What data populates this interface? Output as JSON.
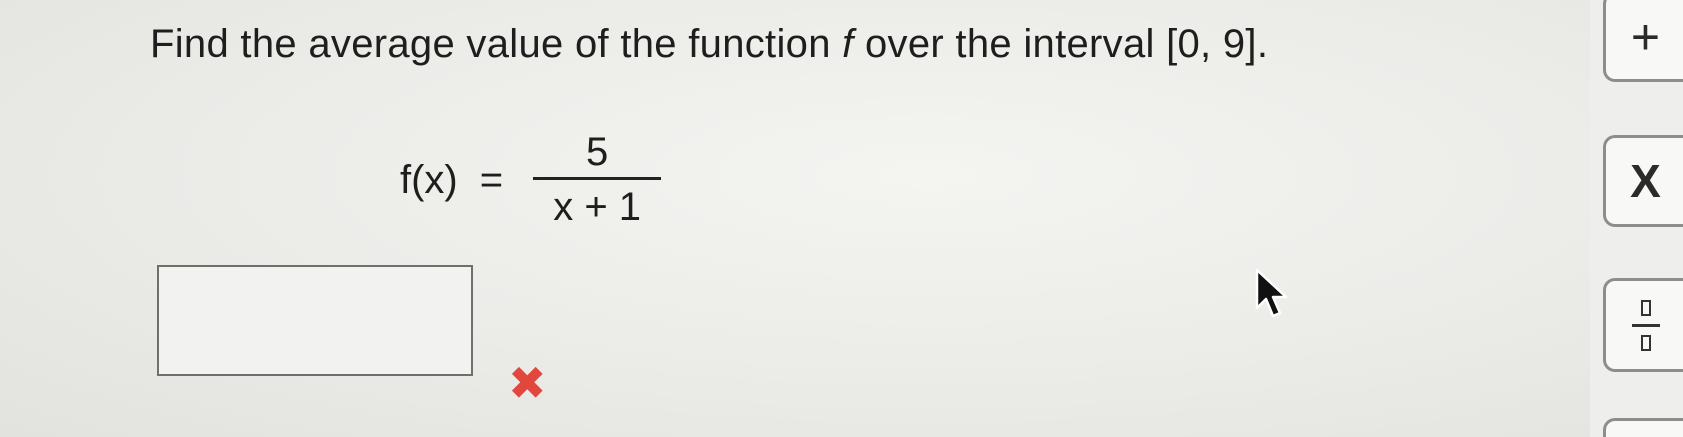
{
  "question": {
    "prefix": "Find the average value of the function ",
    "function_name": "f",
    "suffix": " over the interval [0, 9]."
  },
  "formula": {
    "lhs": "f(x)",
    "equals": "=",
    "numerator": "5",
    "denominator": "x + 1"
  },
  "answer": {
    "value": "",
    "status_symbol": "✖"
  },
  "toolbar": {
    "plus_label": "+",
    "times_label": "X"
  },
  "icons": {
    "cursor": "arrow-cursor-icon",
    "fraction": "fraction-icon",
    "incorrect": "incorrect-x-icon"
  },
  "colors": {
    "incorrect": "#e2473d",
    "text": "#1e1e1e"
  }
}
